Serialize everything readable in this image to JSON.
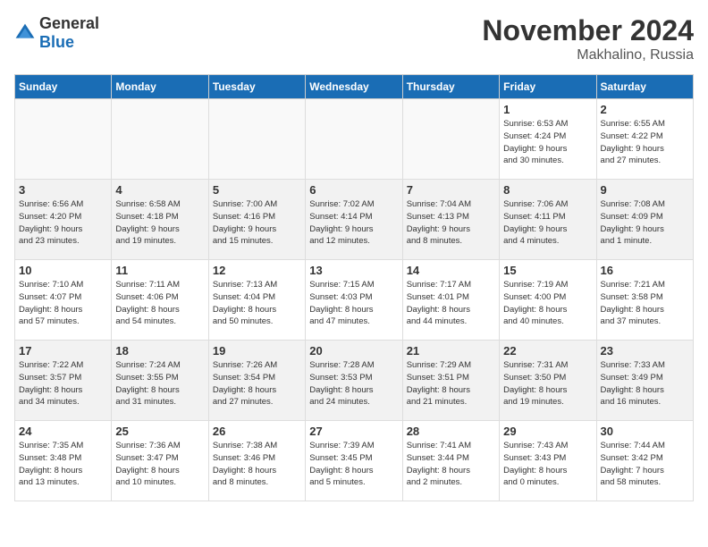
{
  "logo": {
    "general": "General",
    "blue": "Blue"
  },
  "title": {
    "month": "November 2024",
    "location": "Makhalino, Russia"
  },
  "headers": [
    "Sunday",
    "Monday",
    "Tuesday",
    "Wednesday",
    "Thursday",
    "Friday",
    "Saturday"
  ],
  "weeks": [
    [
      {
        "day": "",
        "info": ""
      },
      {
        "day": "",
        "info": ""
      },
      {
        "day": "",
        "info": ""
      },
      {
        "day": "",
        "info": ""
      },
      {
        "day": "",
        "info": ""
      },
      {
        "day": "1",
        "info": "Sunrise: 6:53 AM\nSunset: 4:24 PM\nDaylight: 9 hours\nand 30 minutes."
      },
      {
        "day": "2",
        "info": "Sunrise: 6:55 AM\nSunset: 4:22 PM\nDaylight: 9 hours\nand 27 minutes."
      }
    ],
    [
      {
        "day": "3",
        "info": "Sunrise: 6:56 AM\nSunset: 4:20 PM\nDaylight: 9 hours\nand 23 minutes."
      },
      {
        "day": "4",
        "info": "Sunrise: 6:58 AM\nSunset: 4:18 PM\nDaylight: 9 hours\nand 19 minutes."
      },
      {
        "day": "5",
        "info": "Sunrise: 7:00 AM\nSunset: 4:16 PM\nDaylight: 9 hours\nand 15 minutes."
      },
      {
        "day": "6",
        "info": "Sunrise: 7:02 AM\nSunset: 4:14 PM\nDaylight: 9 hours\nand 12 minutes."
      },
      {
        "day": "7",
        "info": "Sunrise: 7:04 AM\nSunset: 4:13 PM\nDaylight: 9 hours\nand 8 minutes."
      },
      {
        "day": "8",
        "info": "Sunrise: 7:06 AM\nSunset: 4:11 PM\nDaylight: 9 hours\nand 4 minutes."
      },
      {
        "day": "9",
        "info": "Sunrise: 7:08 AM\nSunset: 4:09 PM\nDaylight: 9 hours\nand 1 minute."
      }
    ],
    [
      {
        "day": "10",
        "info": "Sunrise: 7:10 AM\nSunset: 4:07 PM\nDaylight: 8 hours\nand 57 minutes."
      },
      {
        "day": "11",
        "info": "Sunrise: 7:11 AM\nSunset: 4:06 PM\nDaylight: 8 hours\nand 54 minutes."
      },
      {
        "day": "12",
        "info": "Sunrise: 7:13 AM\nSunset: 4:04 PM\nDaylight: 8 hours\nand 50 minutes."
      },
      {
        "day": "13",
        "info": "Sunrise: 7:15 AM\nSunset: 4:03 PM\nDaylight: 8 hours\nand 47 minutes."
      },
      {
        "day": "14",
        "info": "Sunrise: 7:17 AM\nSunset: 4:01 PM\nDaylight: 8 hours\nand 44 minutes."
      },
      {
        "day": "15",
        "info": "Sunrise: 7:19 AM\nSunset: 4:00 PM\nDaylight: 8 hours\nand 40 minutes."
      },
      {
        "day": "16",
        "info": "Sunrise: 7:21 AM\nSunset: 3:58 PM\nDaylight: 8 hours\nand 37 minutes."
      }
    ],
    [
      {
        "day": "17",
        "info": "Sunrise: 7:22 AM\nSunset: 3:57 PM\nDaylight: 8 hours\nand 34 minutes."
      },
      {
        "day": "18",
        "info": "Sunrise: 7:24 AM\nSunset: 3:55 PM\nDaylight: 8 hours\nand 31 minutes."
      },
      {
        "day": "19",
        "info": "Sunrise: 7:26 AM\nSunset: 3:54 PM\nDaylight: 8 hours\nand 27 minutes."
      },
      {
        "day": "20",
        "info": "Sunrise: 7:28 AM\nSunset: 3:53 PM\nDaylight: 8 hours\nand 24 minutes."
      },
      {
        "day": "21",
        "info": "Sunrise: 7:29 AM\nSunset: 3:51 PM\nDaylight: 8 hours\nand 21 minutes."
      },
      {
        "day": "22",
        "info": "Sunrise: 7:31 AM\nSunset: 3:50 PM\nDaylight: 8 hours\nand 19 minutes."
      },
      {
        "day": "23",
        "info": "Sunrise: 7:33 AM\nSunset: 3:49 PM\nDaylight: 8 hours\nand 16 minutes."
      }
    ],
    [
      {
        "day": "24",
        "info": "Sunrise: 7:35 AM\nSunset: 3:48 PM\nDaylight: 8 hours\nand 13 minutes."
      },
      {
        "day": "25",
        "info": "Sunrise: 7:36 AM\nSunset: 3:47 PM\nDaylight: 8 hours\nand 10 minutes."
      },
      {
        "day": "26",
        "info": "Sunrise: 7:38 AM\nSunset: 3:46 PM\nDaylight: 8 hours\nand 8 minutes."
      },
      {
        "day": "27",
        "info": "Sunrise: 7:39 AM\nSunset: 3:45 PM\nDaylight: 8 hours\nand 5 minutes."
      },
      {
        "day": "28",
        "info": "Sunrise: 7:41 AM\nSunset: 3:44 PM\nDaylight: 8 hours\nand 2 minutes."
      },
      {
        "day": "29",
        "info": "Sunrise: 7:43 AM\nSunset: 3:43 PM\nDaylight: 8 hours\nand 0 minutes."
      },
      {
        "day": "30",
        "info": "Sunrise: 7:44 AM\nSunset: 3:42 PM\nDaylight: 7 hours\nand 58 minutes."
      }
    ]
  ]
}
